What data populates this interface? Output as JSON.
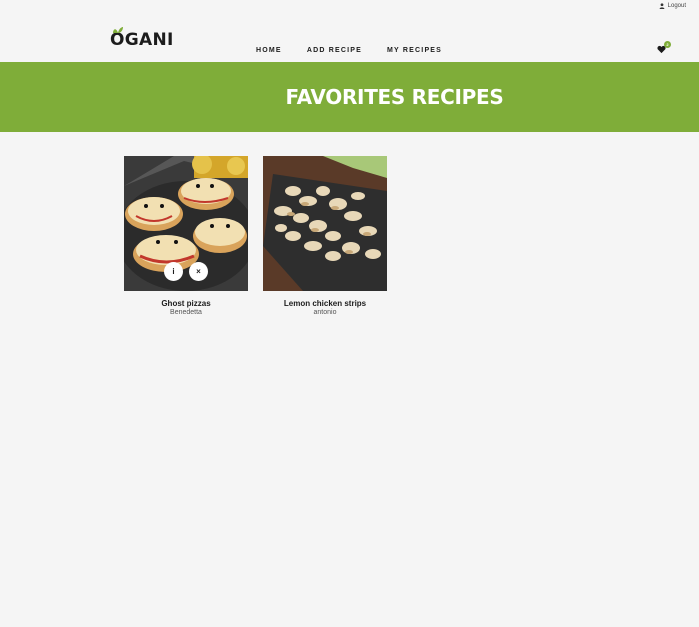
{
  "topbar": {
    "logout_label": "Logout"
  },
  "header": {
    "logo_text": "OGANI",
    "nav": [
      {
        "label": "HOME"
      },
      {
        "label": "ADD RECIPE"
      },
      {
        "label": "MY RECIPES"
      }
    ],
    "favorites_count": "2"
  },
  "banner": {
    "title": "FAVORITES RECIPES"
  },
  "recipes": [
    {
      "title": "Ghost pizzas",
      "author": "Benedetta",
      "info_label": "i",
      "remove_label": "×"
    },
    {
      "title": "Lemon chicken strips",
      "author": "antonio"
    }
  ],
  "colors": {
    "accent": "#7fad39",
    "background": "#f5f5f5",
    "text": "#1c1c1c"
  }
}
